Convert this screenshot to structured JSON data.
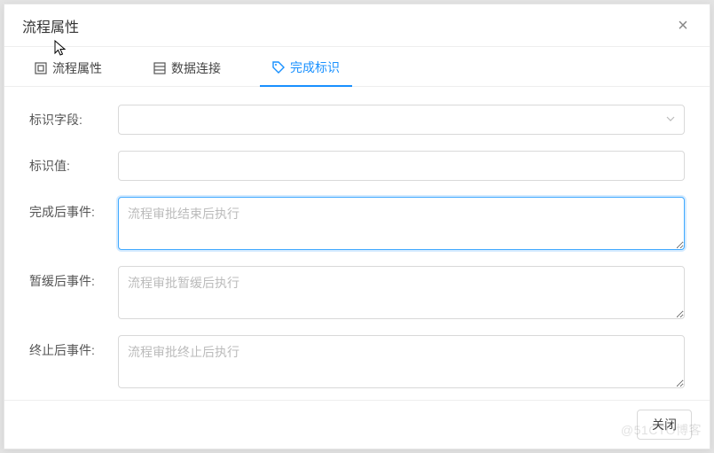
{
  "dialog": {
    "title": "流程属性",
    "close_label": "×"
  },
  "tabs": {
    "items": [
      {
        "label": "流程属性",
        "icon": "properties-icon",
        "active": false
      },
      {
        "label": "数据连接",
        "icon": "data-connection-icon",
        "active": false
      },
      {
        "label": "完成标识",
        "icon": "tag-icon",
        "active": true
      }
    ]
  },
  "form": {
    "field_flag": {
      "label": "标识字段:",
      "value": ""
    },
    "field_value": {
      "label": "标识值:",
      "value": ""
    },
    "after_complete": {
      "label": "完成后事件:",
      "value": "",
      "placeholder": "流程审批结束后执行"
    },
    "after_defer": {
      "label": "暂缓后事件:",
      "value": "",
      "placeholder": "流程审批暂缓后执行"
    },
    "after_terminate": {
      "label": "终止后事件:",
      "value": "",
      "placeholder": "流程审批终止后执行"
    }
  },
  "footer": {
    "close_btn": "关闭"
  },
  "watermark": "@51CTO博客"
}
